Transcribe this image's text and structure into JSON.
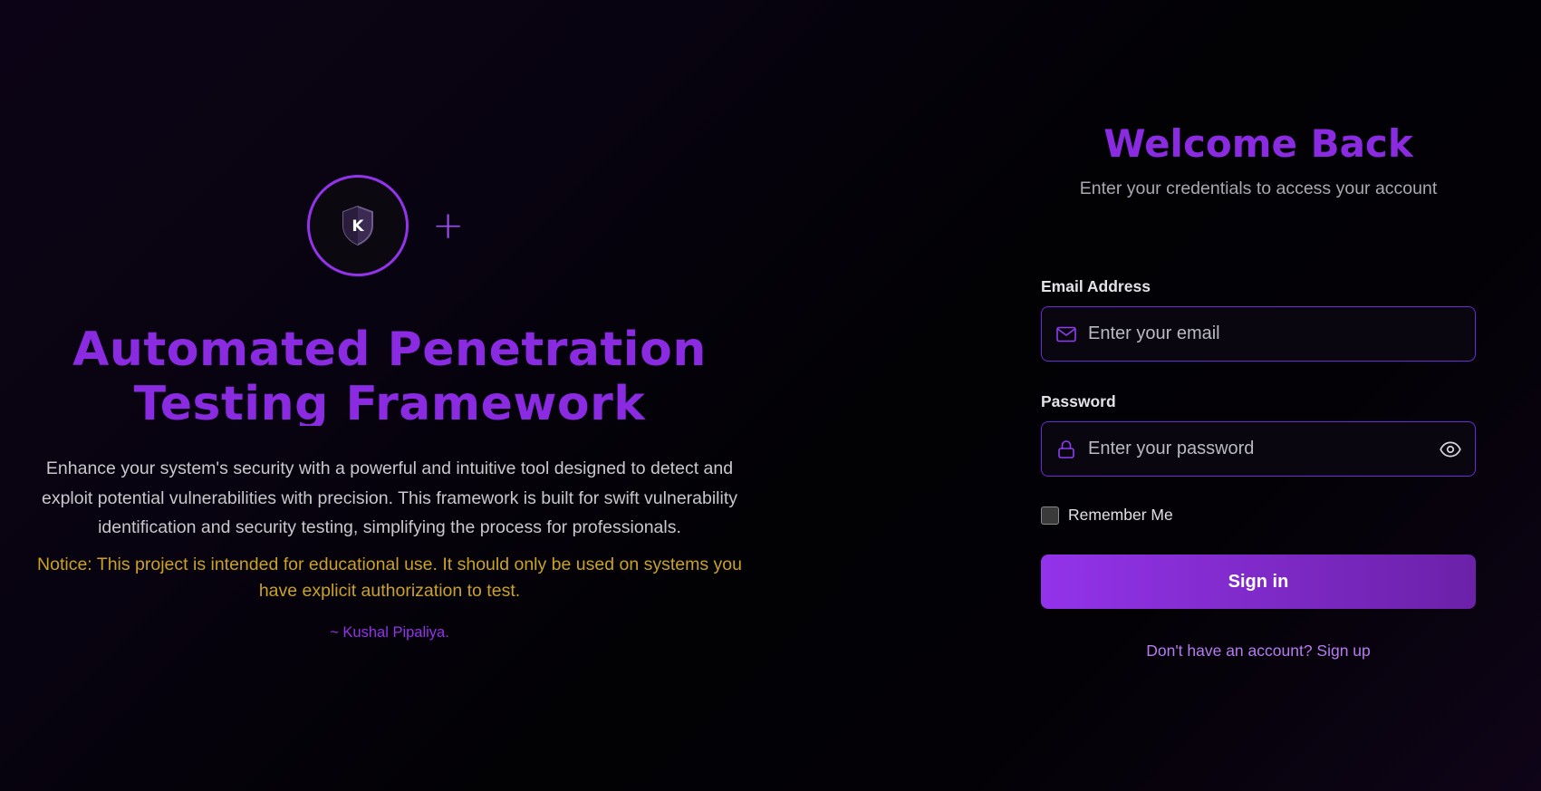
{
  "hero": {
    "title": "Automated Penetration Testing Framework",
    "logo_letter": "K",
    "description": "Enhance your system's security with a powerful and intuitive tool designed to detect and exploit potential vulnerabilities with precision. This framework is built for swift vulnerability identification and security testing, simplifying the process for professionals.",
    "notice": "Notice: This project is intended for educational use. It should only be used on systems you have explicit authorization to test.",
    "author": "~ Kushal Pipaliya."
  },
  "login": {
    "title": "Welcome Back",
    "subtitle": "Enter your credentials to access your account",
    "email_label": "Email Address",
    "email_placeholder": "Enter your email",
    "email_value": "",
    "password_label": "Password",
    "password_placeholder": "Enter your password",
    "password_value": "",
    "remember_label": "Remember Me",
    "remember_checked": false,
    "signin_label": "Sign in",
    "signup_text": "Don't have an account? Sign up"
  },
  "icons": {
    "logo": "shield-icon",
    "plus": "plus-icon",
    "email": "mail-icon",
    "password": "lock-icon",
    "toggle_password": "eye-icon"
  },
  "colors": {
    "accent": "#9333ea",
    "accent_dark": "#6b21a8",
    "notice": "#c9a227",
    "background": "#050208"
  }
}
